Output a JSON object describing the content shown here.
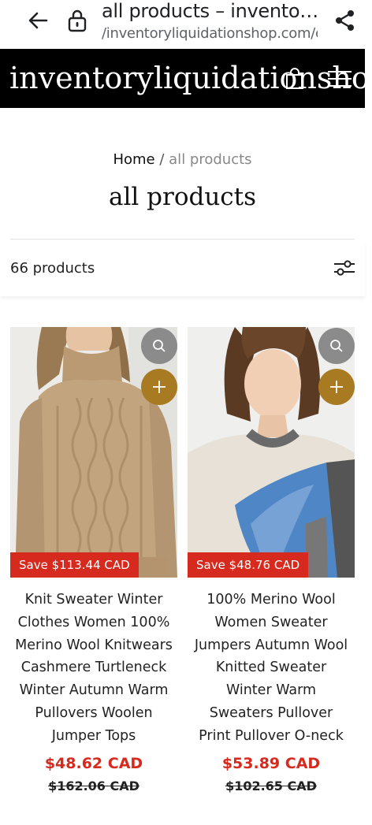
{
  "browser": {
    "tab_title": "all products – inventor…",
    "url": "/inventoryliquidationshop.com/c",
    "icons": [
      "back-arrow-icon",
      "lock-icon",
      "share-icon"
    ]
  },
  "header": {
    "logo": "inventoryliquidationshop.",
    "icons": [
      "shopping-bag-icon",
      "menu-icon"
    ],
    "background": "#000000"
  },
  "breadcrumb": {
    "home": "Home",
    "separator": "/",
    "current": "all products"
  },
  "page_title": "all products",
  "toolbar": {
    "product_count": "66 products",
    "filter_icon": "filter-sliders-icon"
  },
  "products": [
    {
      "name": "Knit Sweater Winter Clothes Women 100% Merino Wool Knitwears Cashmere Turtleneck Winter Autumn Warm Pullovers Woolen Jumper Tops",
      "badge": "Save $113.44 CAD",
      "price": "$48.62 CAD",
      "compare_price": "$162.06 CAD"
    },
    {
      "name": "100% Merino Wool Women Sweater Jumpers Autumn Wool Knitted Sweater Winter Warm Sweaters Pullover Print Pullover O-neck",
      "badge": "Save $48.76 CAD",
      "price": "$53.89 CAD",
      "compare_price": "$102.65 CAD"
    }
  ],
  "colors": {
    "accent_gold": "#a87a22",
    "sale_red": "#d62a1f",
    "quick_view_gray": "#8b8b8b"
  }
}
